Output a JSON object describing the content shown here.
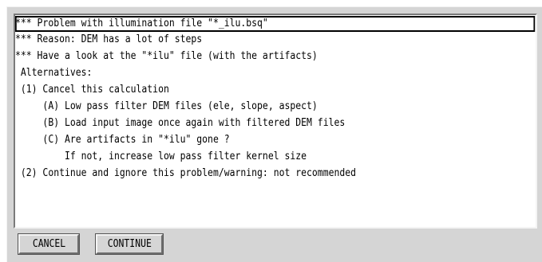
{
  "message_lines": [
    "*** Problem with illumination file \"*_ilu.bsq\"",
    "*** Reason: DEM has a lot of steps",
    "*** Have a look at the \"*ilu\" file (with the artifacts)",
    " Alternatives:",
    " (1) Cancel this calculation",
    "     (A) Low pass filter DEM files (ele, slope, aspect)",
    "     (B) Load input image once again with filtered DEM files",
    "     (C) Are artifacts in \"*ilu\" gone ?",
    "         If not, increase low pass filter kernel size",
    " (2) Continue and ignore this problem/warning: not recommended"
  ],
  "buttons": {
    "cancel": "CANCEL",
    "continue": "CONTINUE"
  },
  "colors": {
    "dialog_background": "#d5d5d5",
    "message_background": "#ffffff",
    "text": "#000000"
  }
}
